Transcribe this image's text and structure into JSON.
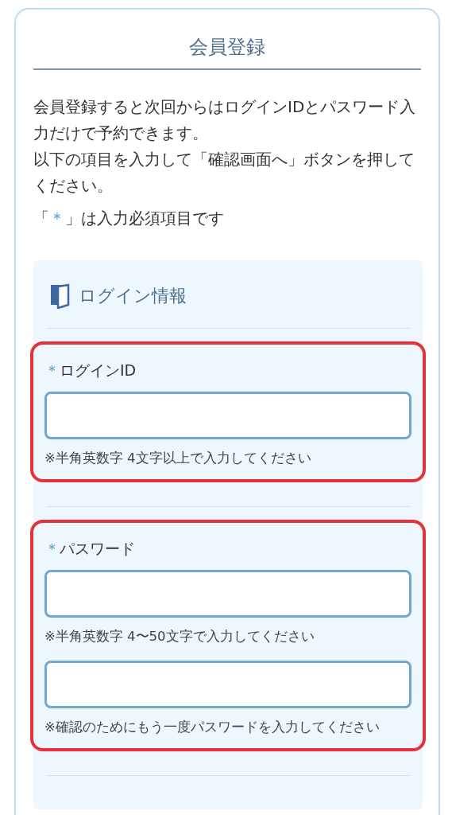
{
  "title": "会員登録",
  "intro": [
    "会員登録すると次回からはログインIDとパスワード入力だけで予約できます。",
    "以下の項目を入力して「確認画面へ」ボタンを押してください。"
  ],
  "required_note": {
    "before": "「",
    "mark": "＊",
    "after": "」は入力必須項目です"
  },
  "section": {
    "heading": "ログイン情報",
    "groups": [
      {
        "highlighted": true,
        "required_mark": "＊",
        "label": "ログインID",
        "fields": [
          {
            "hint": "※半角英数字 4文字以上で入力してください"
          }
        ]
      },
      {
        "highlighted": true,
        "required_mark": "＊",
        "label": "パスワード",
        "fields": [
          {
            "hint": "※半角英数字 4〜50文字で入力してください"
          },
          {
            "hint": "※確認のためにもう一度パスワードを入力してください"
          }
        ]
      }
    ]
  }
}
